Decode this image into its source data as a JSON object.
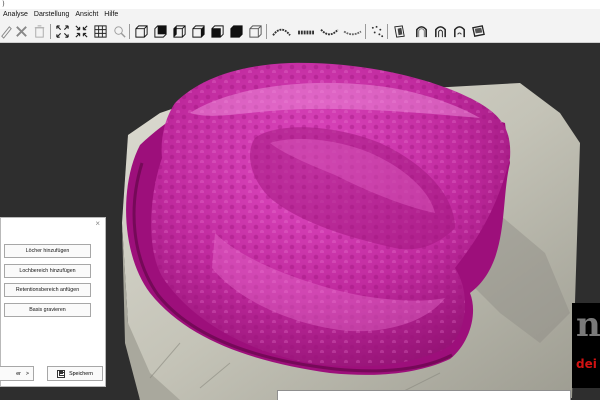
{
  "menu": [
    "Analyse",
    "Darstellung",
    "Ansicht",
    "Hilfe"
  ],
  "toolbar": {
    "icons": [
      "pencil-icon",
      "cross-tools-icon",
      "trash-icon",
      "expand-arrows-icon",
      "collapse-arrows-icon",
      "grid-icon",
      "magnifier-icon",
      "cube-front-icon",
      "cube-back-icon",
      "cube-left-icon",
      "cube-right-icon",
      "cube-top-icon",
      "cube-bottom-icon",
      "cube-outline-icon",
      "tooth-row-top-icon",
      "tooth-row-front-icon",
      "tooth-row-side-icon",
      "scatter-points-icon",
      "tooth-3d-icon-1",
      "tooth-3d-icon-2",
      "tooth-3d-icon-3",
      "tooth-3d-icon-4",
      "tooth-3d-icon-5"
    ]
  },
  "dialog": {
    "close_glyph": "×",
    "buttons": [
      "Löcher hinzufügen",
      "Lochbereich hinzufügen",
      "Retentionsbereich anfügen",
      "Basis gravieren"
    ],
    "back_label": "er",
    "back_arrow": ">",
    "save_label": "Speichern"
  },
  "logo": {
    "glyph": "n",
    "word": "dei e"
  },
  "colors": {
    "model": "#b51a8f",
    "model_highlight": "#e24fc3",
    "stone": "#c9c8bd",
    "background": "#2e2e2e"
  }
}
